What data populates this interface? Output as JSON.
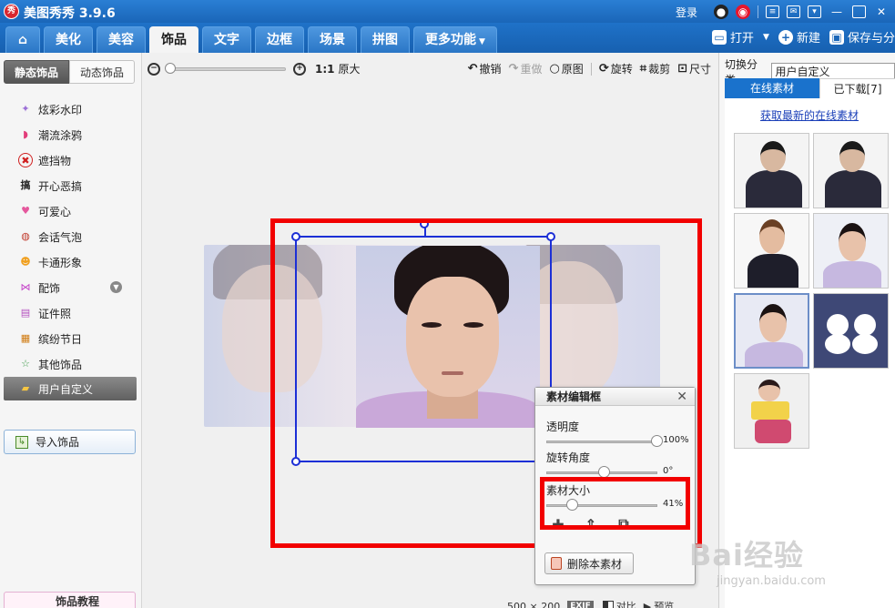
{
  "app": {
    "title": "美图秀秀 3.9.6",
    "logo_text": "秀"
  },
  "titlebar": {
    "login_label": "登录"
  },
  "nav": {
    "tabs": [
      {
        "label": "",
        "icon": "home-icon"
      },
      {
        "label": "美化"
      },
      {
        "label": "美容"
      },
      {
        "label": "饰品",
        "active": true
      },
      {
        "label": "文字"
      },
      {
        "label": "边框"
      },
      {
        "label": "场景"
      },
      {
        "label": "拼图"
      },
      {
        "label": "更多功能"
      }
    ],
    "open_label": "打开",
    "new_label": "新建",
    "save_label": "保存与分"
  },
  "sidebar": {
    "tabs": [
      "静态饰品",
      "动态饰品"
    ],
    "items": [
      {
        "label": "炫彩水印",
        "icon": "sparkle-icon"
      },
      {
        "label": "潮流涂鸦",
        "icon": "lips-icon"
      },
      {
        "label": "遮挡物",
        "icon": "mask-icon"
      },
      {
        "label": "开心恶搞",
        "icon": "funny-icon",
        "glyph": "搞"
      },
      {
        "label": "可爱心",
        "icon": "heart-icon"
      },
      {
        "label": "会话气泡",
        "icon": "speech-bubble-icon"
      },
      {
        "label": "卡通形象",
        "icon": "cartoon-icon"
      },
      {
        "label": "配饰",
        "icon": "bow-icon"
      },
      {
        "label": "证件照",
        "icon": "id-photo-icon"
      },
      {
        "label": "缤纷节日",
        "icon": "gift-icon"
      },
      {
        "label": "其他饰品",
        "icon": "star-icon"
      },
      {
        "label": "用户自定义",
        "icon": "folder-icon"
      }
    ],
    "import_label": "导入饰品",
    "tutorial_label": "饰品教程"
  },
  "toolbar": {
    "ratio_label": "1:1",
    "original_size_label": "原大",
    "undo_label": "撤销",
    "redo_label": "重做",
    "original_label": "原图",
    "rotate_label": "旋转",
    "crop_label": "裁剪",
    "size_label": "尺寸"
  },
  "editor_panel": {
    "title": "素材编辑框",
    "opacity_label": "透明度",
    "opacity_value": "100%",
    "opacity_level": 1.0,
    "rotation_label": "旋转角度",
    "rotation_value": "0°",
    "rotation_level": 0.5,
    "size_label": "素材大小",
    "size_value": "41%",
    "size_level": 0.2,
    "delete_label": "删除本素材"
  },
  "status": {
    "dimensions": "500 × 200",
    "badge": "EXIF",
    "compare_label": "对比",
    "preview_label": "预览"
  },
  "right_panel": {
    "category_label": "切换分类",
    "category_value": "用户自定义",
    "tabs": [
      "在线素材",
      "已下载[7]"
    ],
    "fetch_link": "获取最新的在线素材"
  },
  "watermark": {
    "main": "Bai经验",
    "sub": "jingyan.baidu.com"
  }
}
